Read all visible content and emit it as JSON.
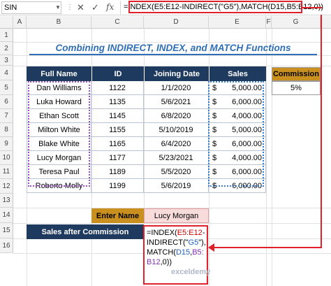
{
  "formula_bar": {
    "name_box": "SIN",
    "formula": "=INDEX(E5:E12-INDIRECT(\"G5\"),MATCH(D15,B5:B12,0))"
  },
  "columns": [
    "A",
    "B",
    "C",
    "D",
    "E",
    "F",
    "G"
  ],
  "rows": [
    "1",
    "2",
    "3",
    "4",
    "5",
    "6",
    "7",
    "8",
    "9",
    "10",
    "11",
    "12",
    "13",
    "14",
    "15",
    "16"
  ],
  "title": "Combining INDIRECT, INDEX, and MATCH Functions",
  "table": {
    "headers": [
      "Full Name",
      "ID",
      "Joining Date",
      "Sales"
    ],
    "rows": [
      {
        "name": "Dan Williams",
        "id": "1122",
        "date": "1/1/2020",
        "cur": "$",
        "sales": "5,000.00"
      },
      {
        "name": "Luka Howard",
        "id": "1135",
        "date": "5/6/2021",
        "cur": "$",
        "sales": "6,000.00"
      },
      {
        "name": "Ethan Scott",
        "id": "1145",
        "date": "6/8/2020",
        "cur": "$",
        "sales": "4,000.00"
      },
      {
        "name": "Milton White",
        "id": "1155",
        "date": "5/10/2019",
        "cur": "$",
        "sales": "5,000.00"
      },
      {
        "name": "Blake White",
        "id": "1165",
        "date": "6/4/2020",
        "cur": "$",
        "sales": "6,000.00"
      },
      {
        "name": "Lucy Morgan",
        "id": "1177",
        "date": "5/23/2021",
        "cur": "$",
        "sales": "4,000.00"
      },
      {
        "name": "Teresa Paul",
        "id": "1189",
        "date": "5/5/2020",
        "cur": "$",
        "sales": "6,000.00"
      },
      {
        "name": "Roberto Molly",
        "id": "1199",
        "date": "5/6/2019",
        "cur": "$",
        "sales": "6,000.00"
      }
    ]
  },
  "commission": {
    "label": "Commission",
    "value": "5%"
  },
  "lookup": {
    "enter_name_label": "Enter Name",
    "enter_name_value": "Lucy Morgan",
    "sales_after_label": "Sales after Commission"
  },
  "popup": {
    "line1_a": "=INDEX(",
    "line1_b": "E5:E12",
    "line1_c": "-",
    "line2_a": "INDIRECT(\"",
    "line2_b": "G5",
    "line2_c": "\"),",
    "line3_a": "MATCH(",
    "line3_b": "D15",
    "line3_c": ",",
    "line3_d": "B5:",
    "line4_a": "B12",
    "line4_b": ",0))"
  },
  "watermark": "exceldemy"
}
